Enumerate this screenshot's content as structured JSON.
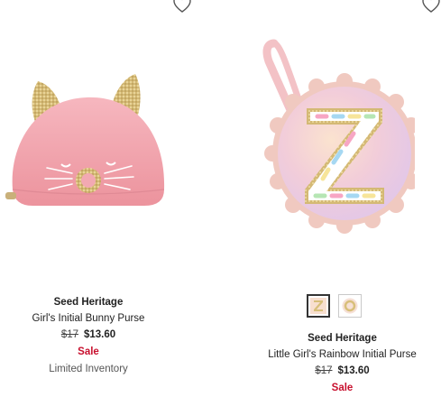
{
  "products": [
    {
      "brand": "Seed Heritage",
      "name": "Girl's Initial Bunny Purse",
      "original_price": "$17",
      "sale_price": "$13.60",
      "badge": "Sale",
      "stock_note": "Limited Inventory"
    },
    {
      "brand": "Seed Heritage",
      "name": "Little Girl's Rainbow Initial Purse",
      "original_price": "$17",
      "sale_price": "$13.60",
      "badge": "Sale",
      "swatches": [
        "Z",
        "O"
      ],
      "selected_swatch": "Z"
    }
  ],
  "colors": {
    "sale": "#c8102e",
    "bunny_pink": "#f1a4ad",
    "glitter_gold": "#d8bf7a"
  }
}
